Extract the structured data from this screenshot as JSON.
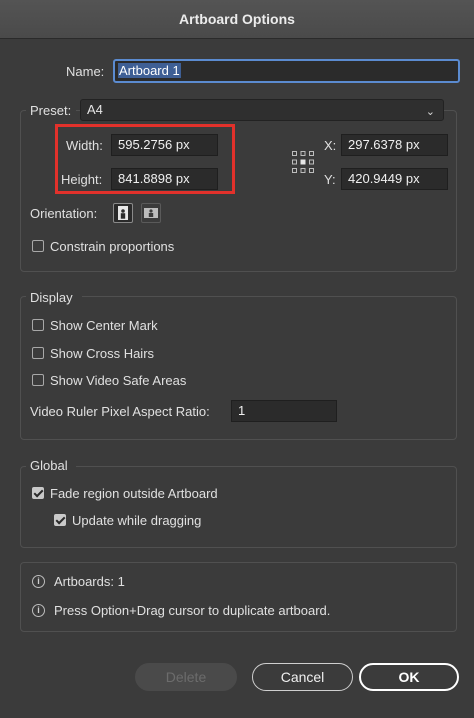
{
  "window": {
    "title": "Artboard Options"
  },
  "name": {
    "label": "Name:",
    "value": "Artboard 1"
  },
  "preset": {
    "label": "Preset:",
    "value": "A4"
  },
  "size": {
    "width_label": "Width:",
    "width_value": "595.2756 px",
    "height_label": "Height:",
    "height_value": "841.8898 px"
  },
  "position": {
    "x_label": "X:",
    "x_value": "297.6378 px",
    "y_label": "Y:",
    "y_value": "420.9449 px"
  },
  "orientation": {
    "label": "Orientation:",
    "selected": "portrait"
  },
  "constrain": {
    "label": "Constrain proportions",
    "checked": false
  },
  "display": {
    "heading": "Display",
    "show_center_mark": {
      "label": "Show Center Mark",
      "checked": false
    },
    "show_cross_hairs": {
      "label": "Show Cross Hairs",
      "checked": false
    },
    "show_video_safe": {
      "label": "Show Video Safe Areas",
      "checked": false
    },
    "ratio_label": "Video Ruler Pixel Aspect Ratio:",
    "ratio_value": "1"
  },
  "global": {
    "heading": "Global",
    "fade_region": {
      "label": "Fade region outside Artboard",
      "checked": true
    },
    "update_dragging": {
      "label": "Update while dragging",
      "checked": true
    }
  },
  "info": {
    "artboards": "Artboards: 1",
    "hint": "Press Option+Drag cursor to duplicate artboard."
  },
  "buttons": {
    "delete": "Delete",
    "cancel": "Cancel",
    "ok": "OK"
  },
  "colors": {
    "background": "#3b3b3b",
    "highlight": "#e2312b",
    "focus": "#5b8bd0"
  }
}
